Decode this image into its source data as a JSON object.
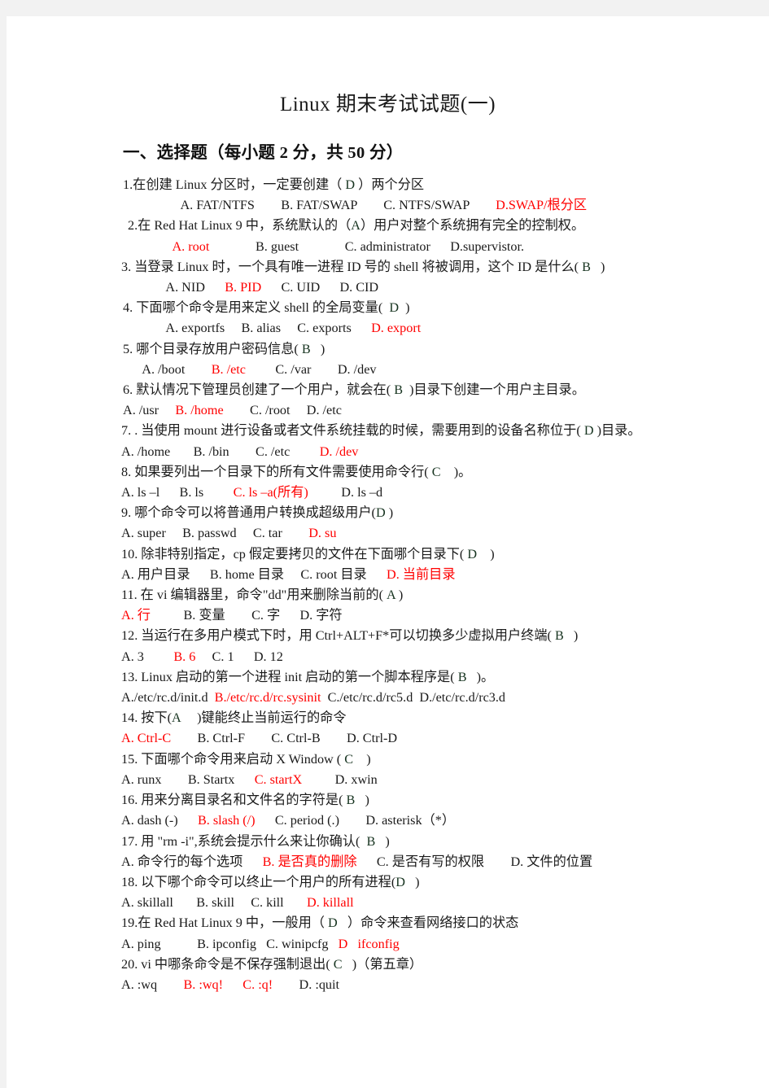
{
  "document": {
    "title": "Linux  期末考试试题(一)",
    "section_heading": "一、选择题（每小题 2 分，共 50 分）",
    "accent_color": "#ff0000",
    "text_color": "#1a1a1a",
    "page_background": "#ffffff",
    "canvas_background": "#f2f2f2"
  },
  "questions": [
    {
      "number": "1",
      "stem_pre": "1.在创建 Linux 分区时，一定要创建（ ",
      "answer": "D",
      "stem_post": " ）两个分区",
      "options_line": [
        {
          "text": "A. FAT/NTFS",
          "color": "black"
        },
        {
          "text": "B. FAT/SWAP",
          "color": "black"
        },
        {
          "text": "C. NTFS/SWAP",
          "color": "black"
        },
        {
          "text": "D.SWAP/根分区",
          "color": "red"
        }
      ],
      "options_raw": "       A. FAT/NTFS        B. FAT/SWAP        C. NTFS/SWAP        D.SWAP/根分区"
    },
    {
      "number": "2",
      "stem_pre": "2.在 Red Hat Linux 9 中，系统默认的（",
      "answer": "A",
      "stem_post": "）用户对整个系统拥有完全的控制权。",
      "options_raw": "        A. root              B. guest              C. administrator      D.supervistor.",
      "options_line": [
        {
          "text": "A. root",
          "color": "red"
        },
        {
          "text": "B. guest",
          "color": "black"
        },
        {
          "text": "C. administrator",
          "color": "black"
        },
        {
          "text": "D.supervistor.",
          "color": "black"
        }
      ]
    },
    {
      "number": "3",
      "stem_pre": "3. 当登录 Linux 时，一个具有唯一进程 ID 号的 shell 将被调用，这个 ID 是什么( ",
      "answer": "B",
      "stem_post": "   )",
      "options_raw": "      A. NID      B. PID      C. UID      D. CID",
      "options_line": [
        {
          "text": "A. NID",
          "color": "black"
        },
        {
          "text": "B. PID",
          "color": "red"
        },
        {
          "text": "C. UID",
          "color": "black"
        },
        {
          "text": "D. CID",
          "color": "black"
        }
      ]
    },
    {
      "number": "4",
      "stem_pre": "4. 下面哪个命令是用来定义 shell 的全局变量(  ",
      "answer": "D",
      "stem_post": "  )",
      "options_raw": "      A. exportfs     B. alias     C. exports      D. export",
      "options_line": [
        {
          "text": "A. exportfs",
          "color": "black"
        },
        {
          "text": "B. alias",
          "color": "black"
        },
        {
          "text": "C. exports",
          "color": "black"
        },
        {
          "text": "D. export",
          "color": "red"
        }
      ]
    },
    {
      "number": "5",
      "stem_pre": "5. 哪个目录存放用户密码信息( ",
      "answer": "B",
      "stem_post": "   )",
      "options_raw": "   A. /boot        B. /etc         C. /var        D. /dev",
      "options_line": [
        {
          "text": "A. /boot",
          "color": "black"
        },
        {
          "text": "B. /etc",
          "color": "red"
        },
        {
          "text": "C. /var",
          "color": "black"
        },
        {
          "text": "D. /dev",
          "color": "black"
        }
      ]
    },
    {
      "number": "6",
      "stem_pre": "6. 默认情况下管理员创建了一个用户，就会在( ",
      "answer": "B",
      "stem_post": "  )目录下创建一个用户主目录。",
      "options_raw": "A. /usr     B. /home        C. /root     D. /etc",
      "options_line": [
        {
          "text": "A. /usr",
          "color": "black"
        },
        {
          "text": "B. /home",
          "color": "red"
        },
        {
          "text": "C. /root",
          "color": "black"
        },
        {
          "text": "D. /etc",
          "color": "black"
        }
      ]
    },
    {
      "number": "7",
      "stem_pre": "7. . 当使用 mount 进行设备或者文件系统挂载的时候，需要用到的设备名称位于( ",
      "answer": "D",
      "stem_post": " )目录。",
      "options_raw": "A. /home       B. /bin        C. /etc         D. /dev",
      "options_line": [
        {
          "text": "A. /home",
          "color": "black"
        },
        {
          "text": "B. /bin",
          "color": "black"
        },
        {
          "text": "C. /etc",
          "color": "black"
        },
        {
          "text": "D. /dev",
          "color": "red"
        }
      ]
    },
    {
      "number": "8",
      "stem_pre": "8. 如果要列出一个目录下的所有文件需要使用命令行( ",
      "answer": "C",
      "stem_post": "    )。",
      "options_raw": "A. ls –l      B. ls         C. ls –a(所有)          D. ls –d",
      "options_line": [
        {
          "text": "A. ls –l",
          "color": "black"
        },
        {
          "text": "B. ls",
          "color": "black"
        },
        {
          "text": "C. ls –a(所有)",
          "color": "red"
        },
        {
          "text": "D. ls –d",
          "color": "black"
        }
      ]
    },
    {
      "number": "9",
      "stem_pre": "9. 哪个命令可以将普通用户转换成超级用户(",
      "answer": "D",
      "stem_post": " )",
      "options_raw": "A. super     B. passwd     C. tar        D. su",
      "options_line": [
        {
          "text": "A. super",
          "color": "black"
        },
        {
          "text": "B. passwd",
          "color": "black"
        },
        {
          "text": "C. tar",
          "color": "black"
        },
        {
          "text": "D. su",
          "color": "red"
        }
      ]
    },
    {
      "number": "10",
      "stem_pre": "10. 除非特别指定，cp 假定要拷贝的文件在下面哪个目录下( ",
      "answer": "D",
      "stem_post": "    )",
      "options_raw": "A. 用户目录      B. home 目录     C. root 目录      D. 当前目录",
      "options_line": [
        {
          "text": "A. 用户目录",
          "color": "black"
        },
        {
          "text": "B. home 目录",
          "color": "black"
        },
        {
          "text": "C. root 目录",
          "color": "black"
        },
        {
          "text": "D. 当前目录",
          "color": "red"
        }
      ]
    },
    {
      "number": "11",
      "stem_pre": "11. 在 vi 编辑器里，命令\"dd\"用来删除当前的( ",
      "answer": "A",
      "stem_post": " )",
      "options_raw": "A. 行          B. 变量        C. 字      D. 字符",
      "options_line": [
        {
          "text": "A. 行",
          "color": "red"
        },
        {
          "text": "B. 变量",
          "color": "black"
        },
        {
          "text": "C. 字",
          "color": "black"
        },
        {
          "text": "D. 字符",
          "color": "black"
        }
      ]
    },
    {
      "number": "12",
      "stem_pre": "12. 当运行在多用户模式下时，用 Ctrl+ALT+F*可以切换多少虚拟用户终端( ",
      "answer": "B",
      "stem_post": "   )",
      "options_raw": "A. 3         B. 6     C. 1      D. 12",
      "options_line": [
        {
          "text": "A. 3",
          "color": "black"
        },
        {
          "text": "B. 6",
          "color": "red"
        },
        {
          "text": "C. 1",
          "color": "black"
        },
        {
          "text": "D. 12",
          "color": "black"
        }
      ]
    },
    {
      "number": "13",
      "stem_pre": "13. Linux 启动的第一个进程 init 启动的第一个脚本程序是( ",
      "answer": "B",
      "stem_post": "   )。",
      "options_raw": "A./etc/rc.d/init.d  B./etc/rc.d/rc.sysinit  C./etc/rc.d/rc5.d  D./etc/rc.d/rc3.d",
      "options_line": [
        {
          "text": "A./etc/rc.d/init.d",
          "color": "black"
        },
        {
          "text": "B./etc/rc.d/rc.sysinit",
          "color": "red"
        },
        {
          "text": "C./etc/rc.d/rc5.d",
          "color": "black"
        },
        {
          "text": "D./etc/rc.d/rc3.d",
          "color": "black"
        }
      ]
    },
    {
      "number": "14",
      "stem_pre": "14. 按下(",
      "answer": "A",
      "stem_post": "     )键能终止当前运行的命令",
      "options_raw": "A. Ctrl-C        B. Ctrl-F        C. Ctrl-B        D. Ctrl-D",
      "options_line": [
        {
          "text": "A. Ctrl-C",
          "color": "red"
        },
        {
          "text": "B. Ctrl-F",
          "color": "black"
        },
        {
          "text": "C. Ctrl-B",
          "color": "black"
        },
        {
          "text": "D. Ctrl-D",
          "color": "black"
        }
      ]
    },
    {
      "number": "15",
      "stem_pre": "15. 下面哪个命令用来启动 X Window ( ",
      "answer": "C",
      "stem_post": "    )",
      "options_raw": "A. runx        B. Startx      C. startX          D. xwin",
      "options_line": [
        {
          "text": "A. runx",
          "color": "black"
        },
        {
          "text": "B. Startx",
          "color": "black"
        },
        {
          "text": "C. startX",
          "color": "red"
        },
        {
          "text": "D. xwin",
          "color": "black"
        }
      ]
    },
    {
      "number": "16",
      "stem_pre": "16. 用来分离目录名和文件名的字符是( ",
      "answer": "B",
      "stem_post": "   )",
      "options_raw": "A. dash (-)      B. slash (/)      C. period (.)        D. asterisk（*）",
      "options_line": [
        {
          "text": "A. dash (-)",
          "color": "black"
        },
        {
          "text": "B. slash (/)",
          "color": "red"
        },
        {
          "text": "C. period (.)",
          "color": "black"
        },
        {
          "text": "D. asterisk（*）",
          "color": "black"
        }
      ]
    },
    {
      "number": "17",
      "stem_pre": "17. 用 \"rm -i\",系统会提示什么来让你确认(  ",
      "answer": "B",
      "stem_post": "   )",
      "options_raw": "A. 命令行的每个选项      B. 是否真的删除      C. 是否有写的权限        D. 文件的位置",
      "options_line": [
        {
          "text": "A. 命令行的每个选项",
          "color": "black"
        },
        {
          "text": "B. 是否真的删除",
          "color": "red"
        },
        {
          "text": "C. 是否有写的权限",
          "color": "black"
        },
        {
          "text": "D. 文件的位置",
          "color": "black"
        }
      ]
    },
    {
      "number": "18",
      "stem_pre": "18. 以下哪个命令可以终止一个用户的所有进程(",
      "answer": "D",
      "stem_post": "   )",
      "options_raw": "A. skillall       B. skill     C. kill       D. killall",
      "options_line": [
        {
          "text": "A. skillall",
          "color": "black"
        },
        {
          "text": "B. skill",
          "color": "black"
        },
        {
          "text": "C. kill",
          "color": "black"
        },
        {
          "text": "D. killall",
          "color": "red"
        }
      ]
    },
    {
      "number": "19",
      "stem_pre": "19.在 Red Hat Linux 9 中，一般用（ ",
      "answer": "D",
      "stem_post": "   ）命令来查看网络接口的状态",
      "options_raw": "A. ping           B. ipconfig   C. winipcfg   D   ifconfig",
      "options_line": [
        {
          "text": "A. ping",
          "color": "black"
        },
        {
          "text": "B. ipconfig",
          "color": "black"
        },
        {
          "text": "C. winipcfg",
          "color": "black"
        },
        {
          "text": "D   ifconfig",
          "color": "red"
        }
      ]
    },
    {
      "number": "20",
      "stem_pre": "20. vi 中哪条命令是不保存强制退出( ",
      "answer": "C",
      "stem_post": "   )（第五章）",
      "options_raw": "A. :wq        B. :wq!      C. :q!        D. :quit",
      "options_line": [
        {
          "text": "A. :wq",
          "color": "black"
        },
        {
          "text": "B. :wq!",
          "color": "red"
        },
        {
          "text": "C. :q!",
          "color": "red"
        },
        {
          "text": "D. :quit",
          "color": "black"
        }
      ]
    }
  ],
  "layout": {
    "stem_indents": [
      143,
      149,
      141,
      143,
      143,
      143,
      141,
      141,
      141,
      141,
      141,
      141,
      141,
      141,
      141,
      141,
      141,
      141,
      141,
      141
    ],
    "option_indents": [
      186,
      172,
      172,
      172,
      155,
      143,
      141,
      141,
      141,
      141,
      141,
      141,
      141,
      141,
      141,
      141,
      141,
      141,
      141,
      141
    ]
  }
}
